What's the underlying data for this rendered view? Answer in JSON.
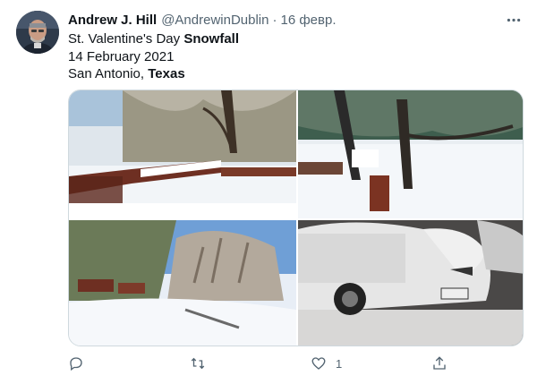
{
  "tweet": {
    "author_name": "Andrew J. Hill",
    "author_handle": "@AndrewinDublin",
    "separator": "·",
    "date": "16 февр.",
    "lines": [
      {
        "prefix": "St. Valentine's Day ",
        "bold": "Snowfall"
      },
      {
        "prefix": "14 February 2021",
        "bold": ""
      },
      {
        "prefix": "San Antonio, ",
        "bold": "Texas"
      }
    ],
    "photos": [
      {
        "icon": "snowy-deck-photo"
      },
      {
        "icon": "snowy-tree-yard-photo"
      },
      {
        "icon": "snowy-hillside-photo"
      },
      {
        "icon": "snow-covered-car-photo"
      }
    ],
    "actions": {
      "reply_count": "",
      "retweet_count": "",
      "like_count": "1",
      "share_count": ""
    }
  },
  "colors": {
    "text_primary": "#0f1419",
    "text_secondary": "#536471",
    "border": "#cfd9de"
  }
}
